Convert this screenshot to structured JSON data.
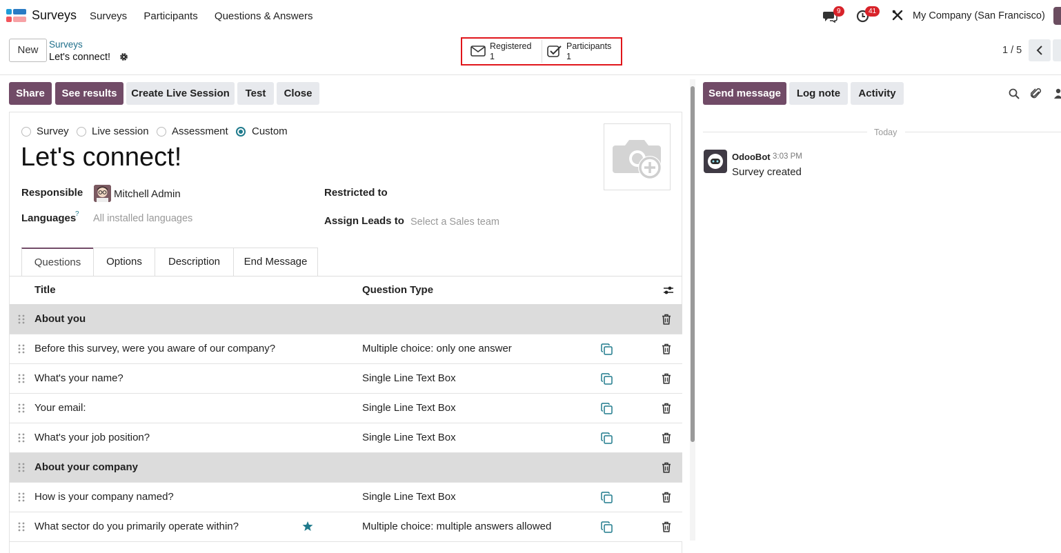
{
  "navbar": {
    "app_name": "Surveys",
    "menu": [
      "Surveys",
      "Participants",
      "Questions & Answers"
    ],
    "messages_count": "9",
    "activities_count": "41",
    "company": "My Company (San Francisco)"
  },
  "control": {
    "new_label": "New",
    "breadcrumb_parent": "Surveys",
    "breadcrumb_current": "Let's connect!",
    "stat_registered_label": "Registered",
    "stat_registered_value": "1",
    "stat_participants_label": "Participants",
    "stat_participants_value": "1",
    "pager": "1 / 5"
  },
  "actions": {
    "share": "Share",
    "see_results": "See results",
    "create_live_session": "Create Live Session",
    "test": "Test",
    "close": "Close"
  },
  "form": {
    "survey_types": [
      "Survey",
      "Live session",
      "Assessment",
      "Custom"
    ],
    "selected_type": "Custom",
    "title": "Let's connect!",
    "responsible_label": "Responsible",
    "responsible_value": "Mitchell Admin",
    "languages_label": "Languages",
    "languages_help": "?",
    "languages_placeholder": "All installed languages",
    "restricted_label": "Restricted to",
    "assign_leads_label": "Assign Leads to",
    "assign_leads_placeholder": "Select a Sales team"
  },
  "tabs": [
    "Questions",
    "Options",
    "Description",
    "End Message"
  ],
  "table": {
    "col_title": "Title",
    "col_type": "Question Type",
    "rows": [
      {
        "title": "About you",
        "type": "",
        "section": true
      },
      {
        "title": "Before this survey, were you aware of our company?",
        "type": "Multiple choice: only one answer",
        "section": false
      },
      {
        "title": "What's your name?",
        "type": "Single Line Text Box",
        "section": false
      },
      {
        "title": "Your email:",
        "type": "Single Line Text Box",
        "section": false
      },
      {
        "title": "What's your job position?",
        "type": "Single Line Text Box",
        "section": false
      },
      {
        "title": "About your company",
        "type": "",
        "section": true
      },
      {
        "title": "How is your company named?",
        "type": "Single Line Text Box",
        "section": false
      },
      {
        "title": "What sector do you primarily operate within?",
        "type": "Multiple choice: multiple answers allowed",
        "section": false,
        "starred": true
      }
    ]
  },
  "chatter": {
    "send_message": "Send message",
    "log_note": "Log note",
    "activity": "Activity",
    "date_separator": "Today",
    "author": "OdooBot",
    "time": "3:03 PM",
    "message": "Survey created"
  },
  "colors": {
    "brand": "#714b67",
    "accent": "#1f7a8c",
    "highlight_box": "#e0151a",
    "badge": "#d8232a"
  }
}
